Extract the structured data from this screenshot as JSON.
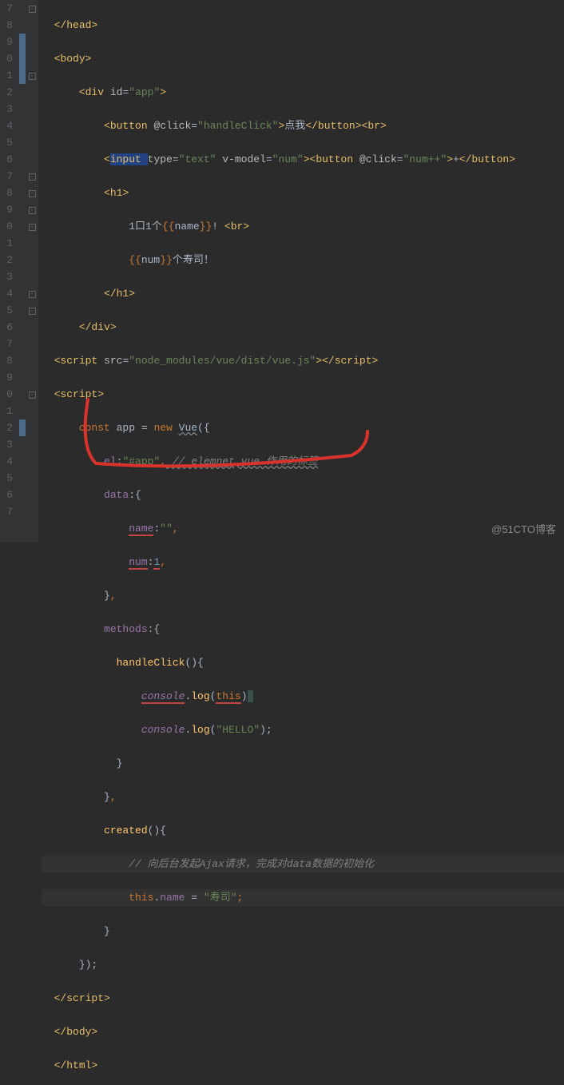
{
  "lineNumbers": [
    "7",
    "8",
    "9",
    "0",
    "1",
    "2",
    "3",
    "4",
    "5",
    "6",
    "7",
    "8",
    "9",
    "0",
    "1",
    "2",
    "3",
    "4",
    "5",
    "6",
    "7",
    "8",
    "9",
    "0",
    "1",
    "2",
    "3",
    "4",
    "5",
    "6",
    "7"
  ],
  "folds": [
    "⊟",
    "",
    "",
    "",
    "⊟",
    "",
    "",
    "",
    "",
    "",
    "⊟",
    "⊟",
    "⊟",
    "⊟",
    "",
    "",
    "",
    "⊟",
    "⊟",
    "",
    "",
    "",
    "",
    "⊟",
    "",
    "",
    "",
    "",
    "",
    "",
    ""
  ],
  "marks": [
    "",
    "",
    "blue",
    "blue",
    "blue",
    "",
    "",
    "",
    "",
    "",
    "",
    "",
    "",
    "",
    "",
    "",
    "",
    "",
    "",
    "",
    "",
    "",
    "",
    "",
    "",
    "blue",
    "",
    "",
    "",
    "",
    ""
  ],
  "code": {
    "l0": {
      "pre": "  ",
      "t1": "</",
      "tag": "head",
      "t2": ">"
    },
    "l1": {
      "pre": "  ",
      "t1": "<",
      "tag": "body",
      "t2": ">"
    },
    "l2": {
      "pre": "      ",
      "t1": "<",
      "tag": "div ",
      "attr": "id",
      "eq": "=",
      "str": "\"app\"",
      "t2": ">"
    },
    "l3": {
      "pre": "          ",
      "t1": "<",
      "tag": "button ",
      "attr": "@click",
      "eq": "=",
      "str": "\"handleClick\"",
      "t2": ">",
      "txt": "点我",
      "t3": "</",
      "tag2": "button",
      "t4": "><",
      "tag3": "br",
      "t5": ">"
    },
    "l4": {
      "pre": "          ",
      "t1": "<",
      "tag": "input ",
      "attr1": "type",
      "eq1": "=",
      "str1": "\"text\" ",
      "attr2": "v-model",
      "eq2": "=",
      "str2": "\"num\"",
      "t2": "><",
      "tag2": "button ",
      "attr3": "@click",
      "eq3": "=",
      "str3": "\"num++\"",
      "t3": ">",
      "txt": "+",
      "t4": "</",
      "tag3": "button",
      "t5": ">"
    },
    "l5": {
      "pre": "          ",
      "t1": "<",
      "tag": "h1",
      "t2": ">"
    },
    "l6": {
      "pre": "              ",
      "txt1": "1口1个",
      "m1": "{{",
      "v1": "name",
      "m2": "}}",
      "txt2": "! ",
      "t1": "<",
      "tag": "br",
      "t2": ">"
    },
    "l7": {
      "pre": "              ",
      "m1": "{{",
      "v1": "num",
      "m2": "}}",
      "txt": "个寿司！"
    },
    "l8": {
      "pre": "          ",
      "t1": "</",
      "tag": "h1",
      "t2": ">"
    },
    "l9": {
      "pre": "      ",
      "t1": "</",
      "tag": "div",
      "t2": ">"
    },
    "l10": {
      "pre": "  ",
      "t1": "<",
      "tag": "script ",
      "attr": "src",
      "eq": "=",
      "str": "\"node_modules/vue/dist/vue.js\"",
      "t2": "></",
      "tag2": "script",
      "t3": ">"
    },
    "l11": {
      "pre": "  ",
      "t1": "<",
      "tag": "script",
      "t2": ">"
    },
    "l12": {
      "pre": "      ",
      "kw": "const ",
      "v": "app ",
      "op": "= ",
      "kw2": "new ",
      "cls": "Vue",
      "p": "({"
    },
    "l13": {
      "pre": "          ",
      "k": "el",
      "c": ":",
      "str": "\"#app\"",
      "cm": ",",
      "comm": " // elemnet,vue 作用的标签"
    },
    "l14": {
      "pre": "          ",
      "k": "data",
      "c": ":{"
    },
    "l15": {
      "pre": "              ",
      "k": "name",
      "c": ":",
      "str": "\"\"",
      "cm": ","
    },
    "l16": {
      "pre": "              ",
      "k": "num",
      "c": ":",
      "n": "1",
      "cm": ","
    },
    "l17": {
      "pre": "          ",
      "c": "}",
      "cm": ","
    },
    "l18": {
      "pre": "          ",
      "k": "methods",
      "c": ":{"
    },
    "l19": {
      "pre": "            ",
      "fn": "handleClick",
      "p": "(){"
    },
    "l20": {
      "pre": "                ",
      "o": "console",
      "d": ".",
      "m": "log",
      "p1": "(",
      "kw": "this",
      "p2": ")"
    },
    "l21": {
      "pre": "                ",
      "o": "console",
      "d": ".",
      "m": "log",
      "p1": "(",
      "str": "\"HELLO\"",
      "p2": ");"
    },
    "l22": {
      "pre": "            ",
      "c": "}"
    },
    "l23": {
      "pre": "          ",
      "c": "}",
      "cm": ","
    },
    "l24": {
      "pre": "          ",
      "fn": "created",
      "p": "(){"
    },
    "l25": {
      "pre": "              ",
      "comm": "// 向后台发起Ajax请求，完成对data数据的初始化"
    },
    "l26": {
      "pre": "              ",
      "kw": "this",
      "d": ".",
      "v": "name ",
      "op": "= ",
      "str": "\"寿司\"",
      "sc": ";"
    },
    "l27": {
      "pre": "          ",
      "c": "}"
    },
    "l28": {
      "pre": "      ",
      "c": "});"
    },
    "l29": {
      "pre": "  ",
      "t1": "</",
      "tag": "script",
      "t2": ">"
    },
    "l30": {
      "pre": "  ",
      "t1": "</",
      "tag": "body",
      "t2": ">"
    },
    "l31": {
      "pre": "  ",
      "t1": "</",
      "tag": "html",
      "t2": ">"
    }
  },
  "watermark": "@51CTO博客"
}
